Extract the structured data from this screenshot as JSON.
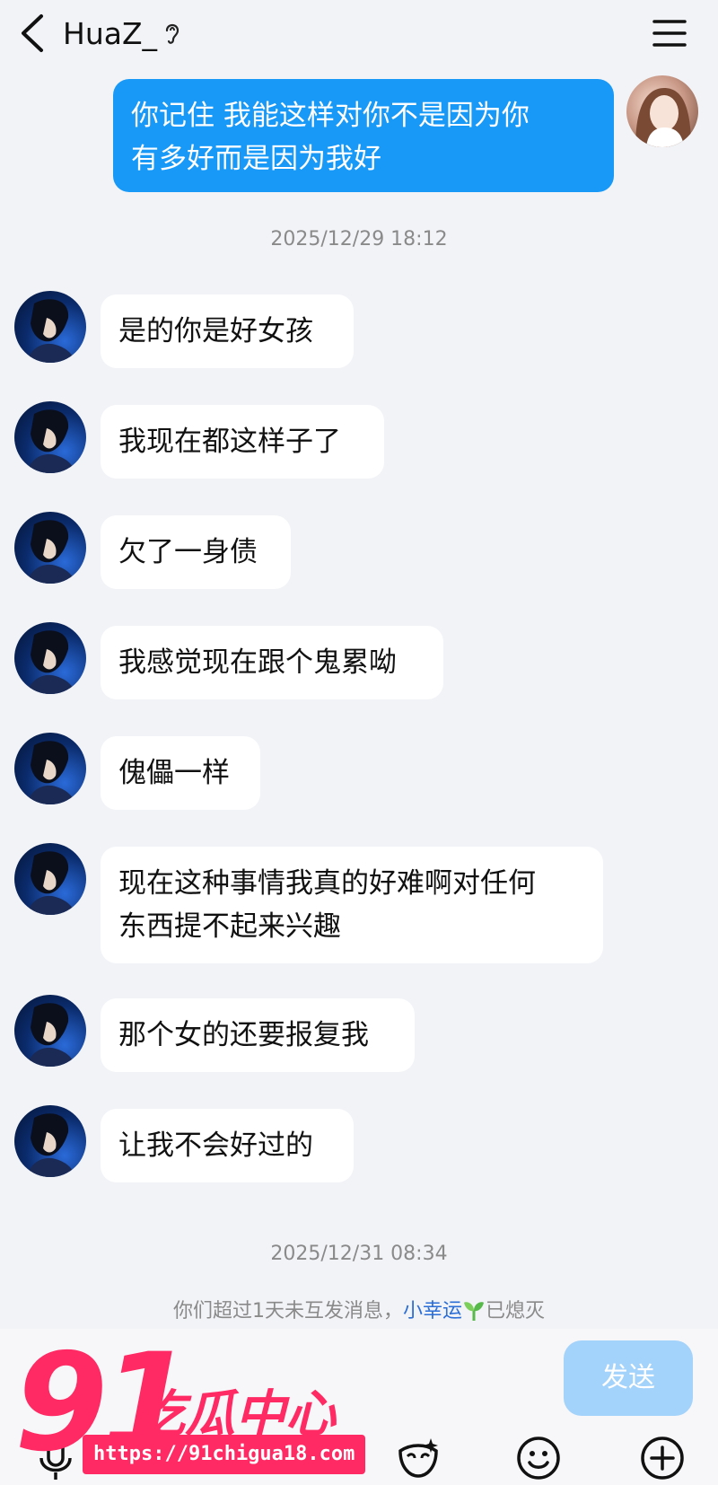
{
  "header": {
    "title": "HuaZ_",
    "icons": [
      "back-arrow-icon",
      "ear-icon",
      "menu-icon"
    ]
  },
  "messages": {
    "m0": {
      "sender": "me",
      "lines": [
        "你记住 我能这样对你不是因为你",
        "有多好而是因为我好"
      ]
    },
    "ts1": "2025/12/29 18:12",
    "m1": {
      "sender": "him",
      "text": "是的你是好女孩"
    },
    "m2": {
      "sender": "him",
      "text": "我现在都这样子了"
    },
    "m3": {
      "sender": "him",
      "text": "欠了一身债"
    },
    "m4": {
      "sender": "him",
      "text": "我感觉现在跟个鬼累呦"
    },
    "m5": {
      "sender": "him",
      "text": "傀儡一样"
    },
    "m6": {
      "sender": "him",
      "lines": [
        "现在这种事情我真的好难啊对任何",
        "东西提不起来兴趣"
      ]
    },
    "m7": {
      "sender": "him",
      "text": "那个女的还要报复我"
    },
    "m8": {
      "sender": "him",
      "text": "让我不会好过的"
    },
    "ts2": "2025/12/31 08:34"
  },
  "system_note": {
    "prefix": "你们超过1天未互发消息，",
    "highlight": "小幸运",
    "suffix": "已熄灭"
  },
  "input": {
    "send_label": "发送",
    "tools": [
      "microphone-icon",
      "mask-icon",
      "smiley-icon",
      "plus-icon"
    ]
  },
  "watermark": {
    "number": "91",
    "text": "吃瓜中心",
    "url": "https://91chigua18.com"
  },
  "colors": {
    "outgoing_bubble": "#1899f8",
    "incoming_bubble": "#ffffff",
    "background": "#f2f3f7",
    "send_button": "#a3d2fb",
    "highlight_link": "#2b6ed6",
    "watermark": "#ff2a63"
  }
}
